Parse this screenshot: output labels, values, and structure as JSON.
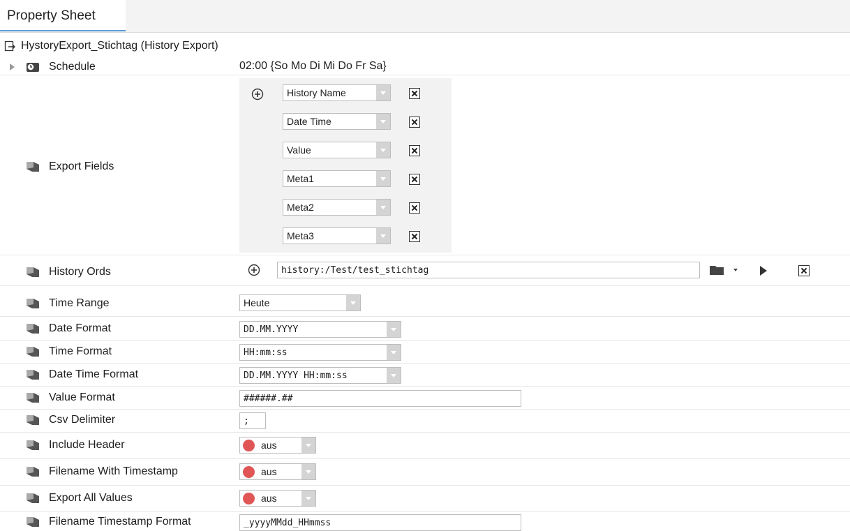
{
  "tab": {
    "label": "Property Sheet"
  },
  "node": {
    "title": "HystoryExport_Stichtag  (History Export)"
  },
  "schedule": {
    "label": "Schedule",
    "value": "02:00 {So Mo Di Mi Do Fr Sa}"
  },
  "export_fields": {
    "label": "Export Fields",
    "items": [
      "History Name",
      "Date Time",
      "Value",
      "Meta1",
      "Meta2",
      "Meta3"
    ]
  },
  "history_ords": {
    "label": "History Ords",
    "value": "history:/Test/test_stichtag"
  },
  "time_range": {
    "label": "Time Range",
    "value": "Heute"
  },
  "date_format": {
    "label": "Date Format",
    "value": "DD.MM.YYYY"
  },
  "time_format": {
    "label": "Time Format",
    "value": "HH:mm:ss"
  },
  "date_time_format": {
    "label": "Date Time Format",
    "value": "DD.MM.YYYY HH:mm:ss"
  },
  "value_format": {
    "label": "Value Format",
    "value": "######.##"
  },
  "csv_delimiter": {
    "label": "Csv Delimiter",
    "value": ";"
  },
  "include_header": {
    "label": "Include Header",
    "value": "aus"
  },
  "filename_with_timestamp": {
    "label": "Filename With Timestamp",
    "value": "aus"
  },
  "export_all_values": {
    "label": "Export All Values",
    "value": "aus"
  },
  "filename_timestamp_format": {
    "label": "Filename Timestamp Format",
    "value": "_yyyyMMdd_HHmmss"
  },
  "colors": {
    "tab_accent": "#5b9bd5",
    "bool_off": "#e05656",
    "dropdown_arrow_bg": "#d4d4d4"
  }
}
